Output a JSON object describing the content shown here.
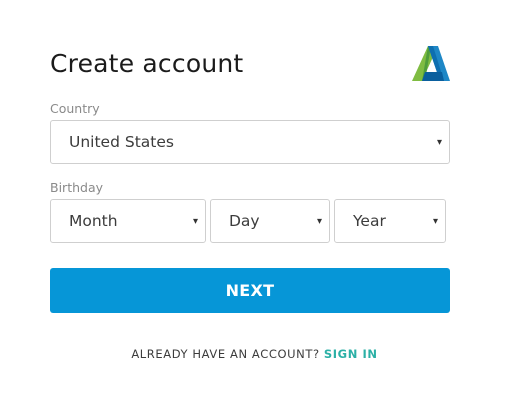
{
  "header": {
    "title": "Create account",
    "logo_icon": "autodesk-logo-icon"
  },
  "country": {
    "label": "Country",
    "value": "United States"
  },
  "birthday": {
    "label": "Birthday",
    "month": "Month",
    "day": "Day",
    "year": "Year"
  },
  "caret_glyph": "▾",
  "actions": {
    "next_label": "NEXT",
    "already_text": "ALREADY HAVE AN ACCOUNT?",
    "signin_label": "SIGN IN"
  },
  "colors": {
    "primary_button": "#0696d7",
    "link": "#2bb0a6",
    "label_gray": "#8a8a8a",
    "border": "#cfcfcf"
  }
}
